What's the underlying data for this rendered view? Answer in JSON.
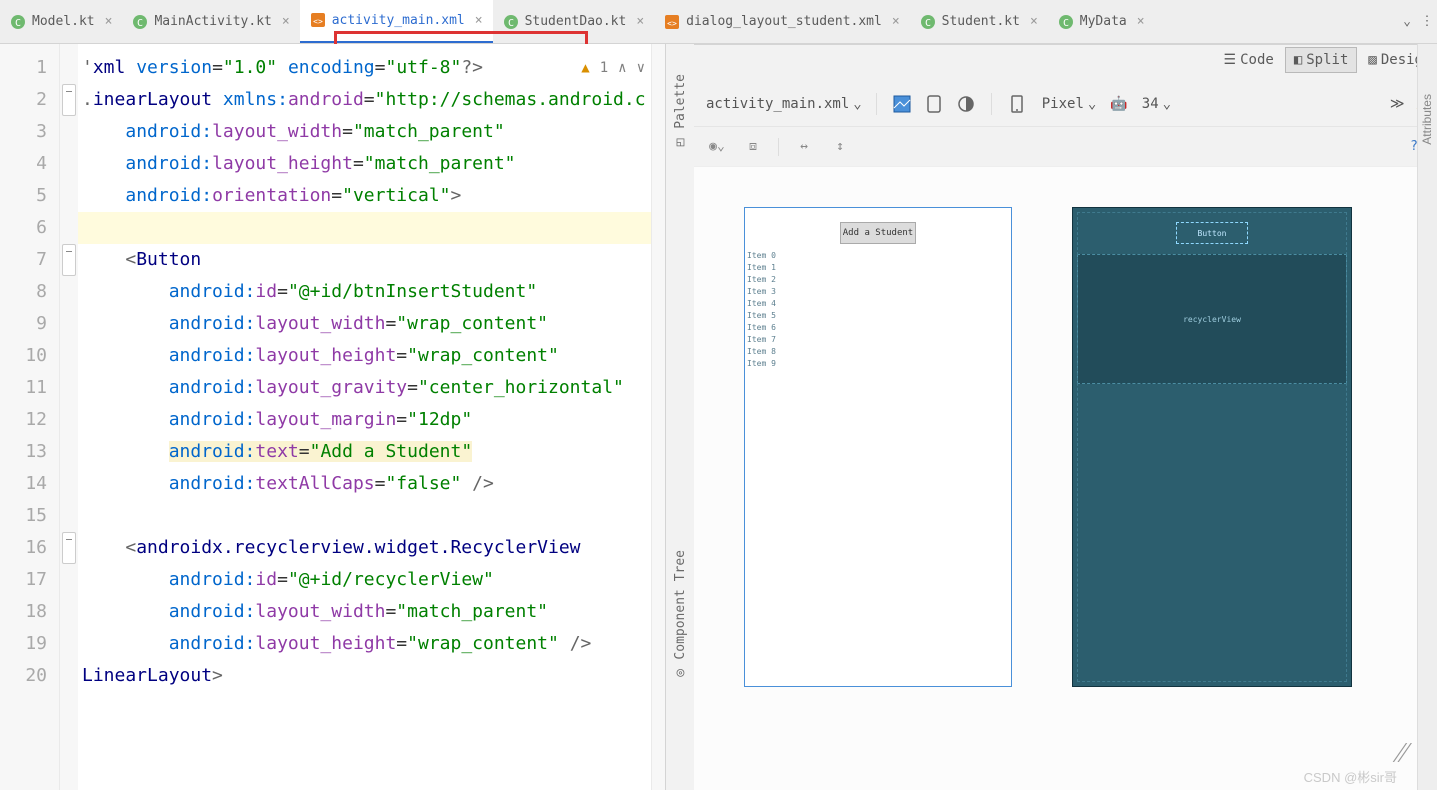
{
  "tabs": [
    {
      "label": "Model.kt",
      "icon": "kotlin-class"
    },
    {
      "label": "MainActivity.kt",
      "icon": "kotlin-class"
    },
    {
      "label": "activity_main.xml",
      "icon": "xml-layout",
      "active": true
    },
    {
      "label": "StudentDao.kt",
      "icon": "kotlin-class"
    },
    {
      "label": "dialog_layout_student.xml",
      "icon": "xml-layout"
    },
    {
      "label": "Student.kt",
      "icon": "kotlin-class"
    },
    {
      "label": "MyData",
      "icon": "kotlin-class",
      "truncated": true
    }
  ],
  "viewmodes": {
    "code": "Code",
    "split": "Split",
    "design": "Desig"
  },
  "editor": {
    "warnings": "1",
    "lines": [
      {
        "n": 1,
        "html": "<span class='t-punc'>'</span><span class='t-tag'>xml</span> <span class='t-attrns'>version</span>=<span class='t-val'>\"1.0\"</span> <span class='t-attrns'>encoding</span>=<span class='t-val'>\"utf-8\"</span><span class='t-punc'>?&gt;</span>"
      },
      {
        "n": 2,
        "html": "<span class='t-punc'>.</span><span class='t-tag'>inearLayout</span> <span class='t-attrns'>xmlns:</span><span class='t-attrafter'>android</span>=<span class='t-val'>\"http://schemas.android.c</span>",
        "fold": true
      },
      {
        "n": 3,
        "html": "    <span class='t-attrns'>android:</span><span class='t-attrafter'>layout_width</span>=<span class='t-val'>\"match_parent\"</span>"
      },
      {
        "n": 4,
        "html": "    <span class='t-attrns'>android:</span><span class='t-attrafter'>layout_height</span>=<span class='t-val'>\"match_parent\"</span>"
      },
      {
        "n": 5,
        "html": "    <span class='t-attrns'>android:</span><span class='t-attrafter'>orientation</span>=<span class='t-val'>\"vertical\"</span><span class='t-punc'>&gt;</span>"
      },
      {
        "n": 6,
        "html": "",
        "caret": true
      },
      {
        "n": 7,
        "html": "    <span class='t-punc'>&lt;</span><span class='t-tag'>Button</span>",
        "fold": true
      },
      {
        "n": 8,
        "html": "        <span class='t-attrns'>android:</span><span class='t-attrafter'>id</span>=<span class='t-val'>\"@+id/btnInsertStudent\"</span>"
      },
      {
        "n": 9,
        "html": "        <span class='t-attrns'>android:</span><span class='t-attrafter'>layout_width</span>=<span class='t-val'>\"wrap_content\"</span>"
      },
      {
        "n": 10,
        "html": "        <span class='t-attrns'>android:</span><span class='t-attrafter'>layout_height</span>=<span class='t-val'>\"wrap_content\"</span>"
      },
      {
        "n": 11,
        "html": "        <span class='t-attrns'>android:</span><span class='t-attrafter'>layout_gravity</span>=<span class='t-val'>\"center_horizontal\"</span>"
      },
      {
        "n": 12,
        "html": "        <span class='t-attrns'>android:</span><span class='t-attrafter'>layout_margin</span>=<span class='t-val'>\"12dp\"</span>"
      },
      {
        "n": 13,
        "html": "        <span class='warnhl'><span class='t-attrns'>android:</span><span class='t-attrafter'>text</span>=<span class='t-val'>\"Add a Student\"</span></span>"
      },
      {
        "n": 14,
        "html": "        <span class='t-attrns'>android:</span><span class='t-attrafter'>textAllCaps</span>=<span class='t-val'>\"false\"</span> <span class='t-punc'>/&gt;</span>"
      },
      {
        "n": 15,
        "html": ""
      },
      {
        "n": 16,
        "html": "    <span class='t-punc'>&lt;</span><span class='t-tag'>androidx.recyclerview.widget.RecyclerView</span>",
        "fold": true
      },
      {
        "n": 17,
        "html": "        <span class='t-attrns'>android:</span><span class='t-attrafter'>id</span>=<span class='t-val'>\"@+id/recyclerView\"</span>"
      },
      {
        "n": 18,
        "html": "        <span class='t-attrns'>android:</span><span class='t-attrafter'>layout_width</span>=<span class='t-val'>\"match_parent\"</span>"
      },
      {
        "n": 19,
        "html": "        <span class='t-attrns'>android:</span><span class='t-attrafter'>layout_height</span>=<span class='t-val'>\"wrap_content\"</span> <span class='t-punc'>/&gt;</span>"
      },
      {
        "n": 20,
        "html": "<span class='t-tag'>LinearLayout</span><span class='t-punc'>&gt;</span>"
      }
    ]
  },
  "vtabs": {
    "palette": "Palette",
    "tree": "Component Tree"
  },
  "design": {
    "filename": "activity_main.xml",
    "device": "Pixel",
    "api": "34",
    "button_text": "Add a Student",
    "items": [
      "Item 0",
      "Item 1",
      "Item 2",
      "Item 3",
      "Item 4",
      "Item 5",
      "Item 6",
      "Item 7",
      "Item 8",
      "Item 9"
    ],
    "bp_button": "Button",
    "bp_recycler": "recyclerView"
  },
  "watermark": "CSDN @彬sir哥",
  "attr_tab": "Attributes"
}
